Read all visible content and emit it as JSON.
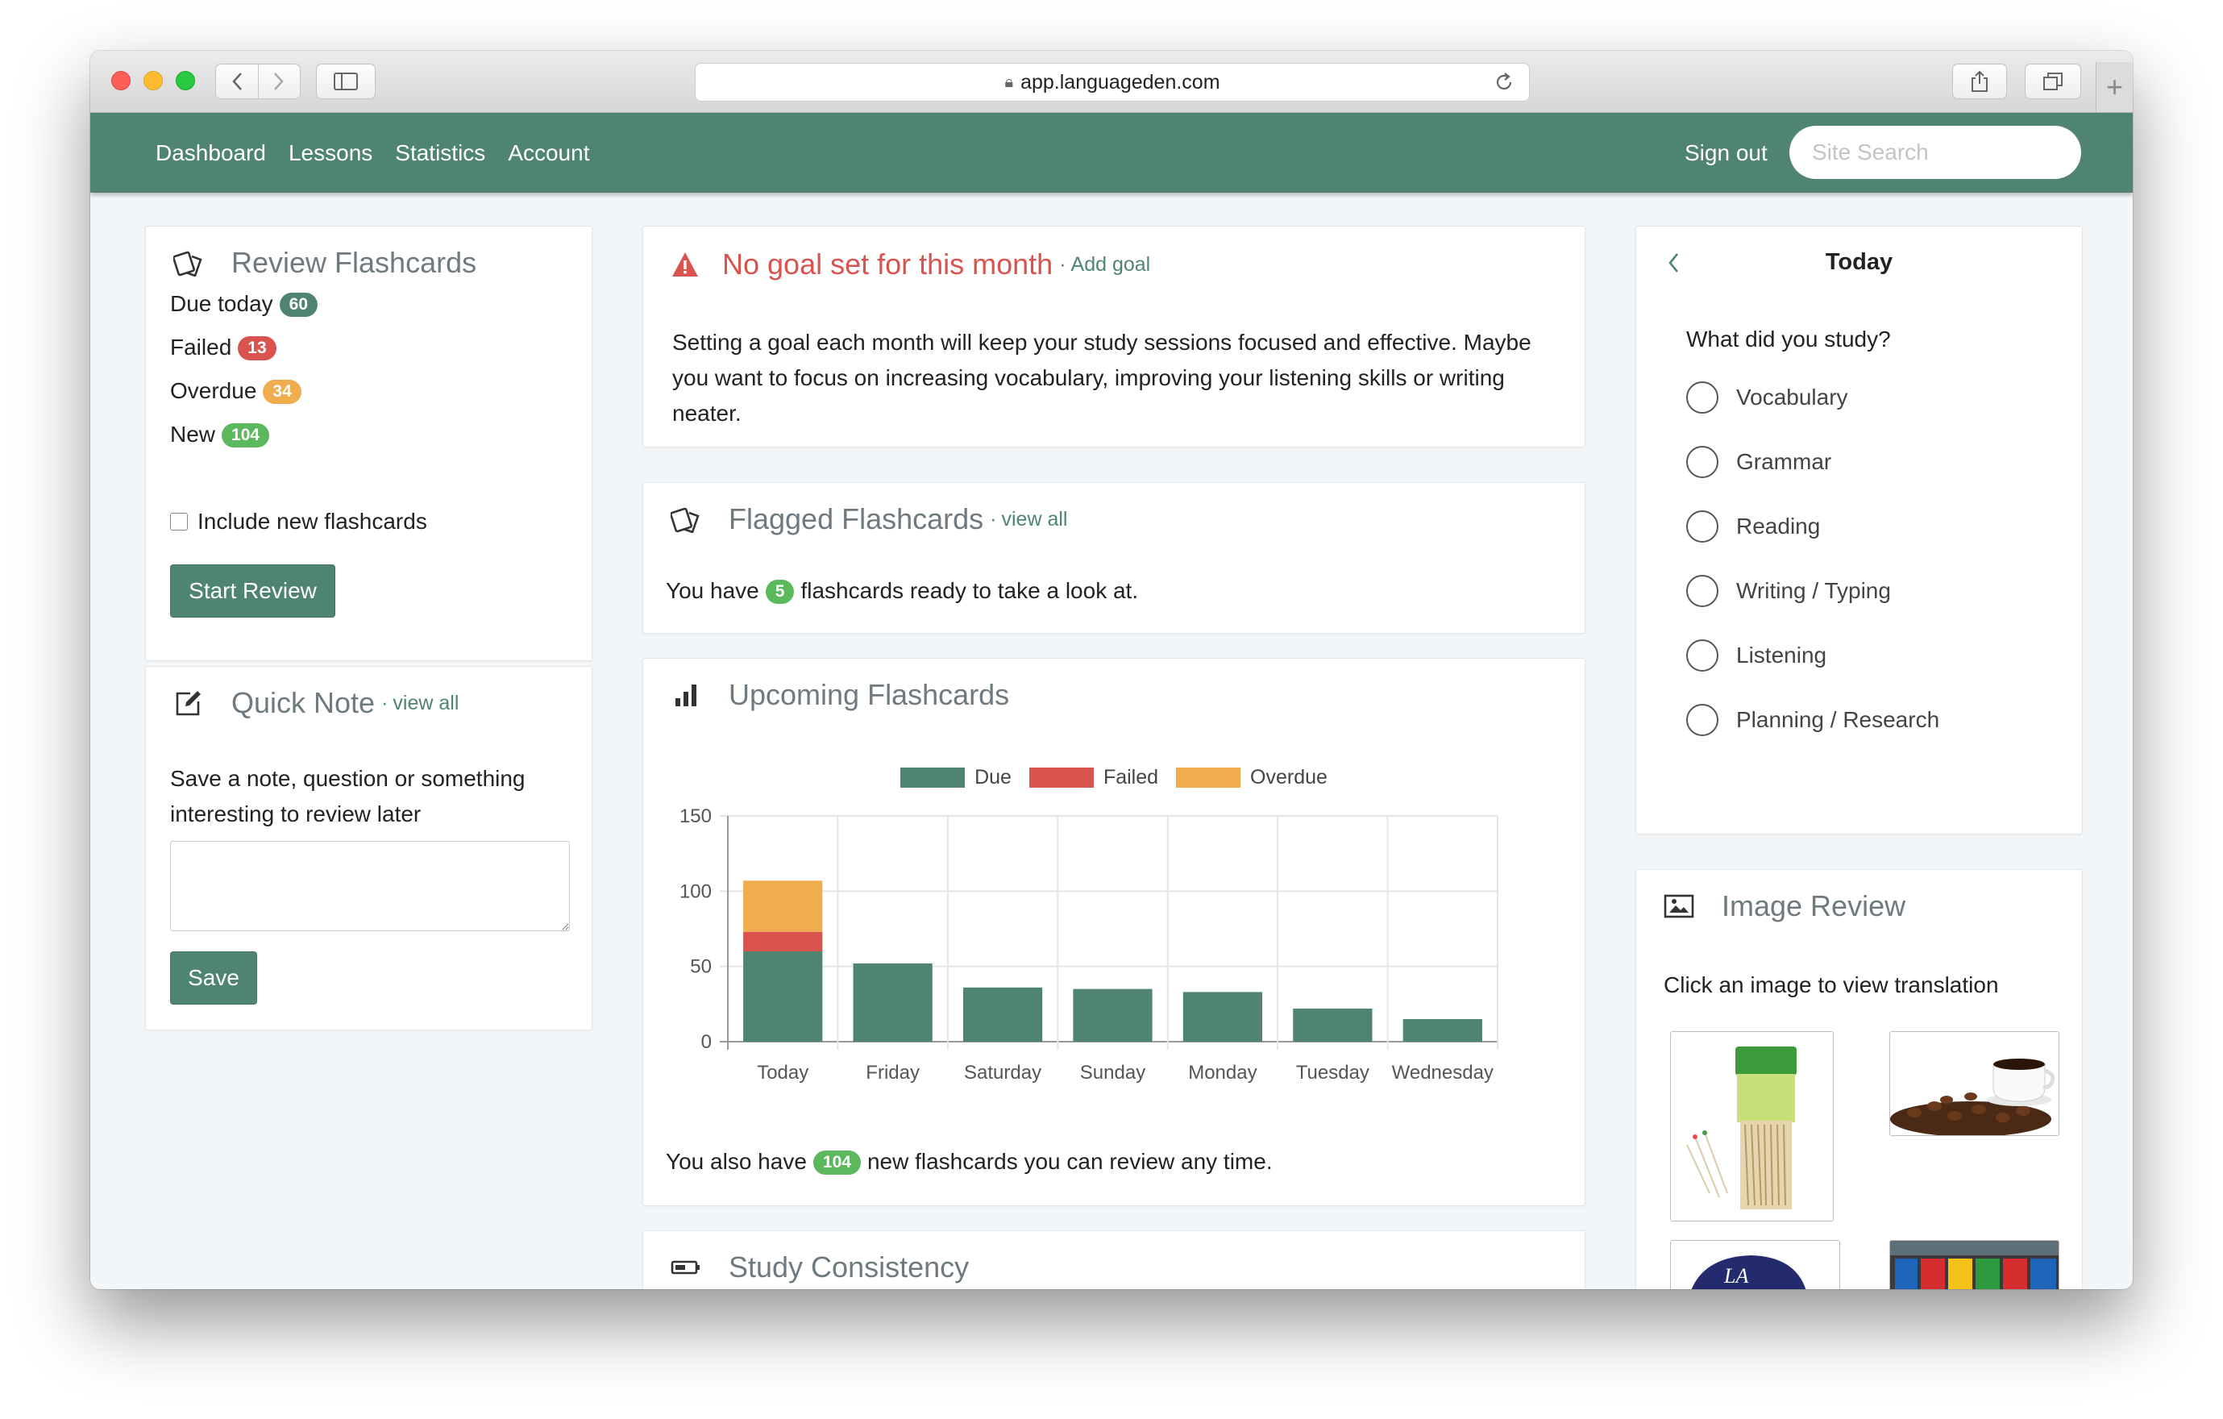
{
  "browser": {
    "url": "app.languageden.com"
  },
  "nav": {
    "links": [
      "Dashboard",
      "Lessons",
      "Statistics",
      "Account"
    ],
    "sign_out": "Sign out",
    "search_placeholder": "Site Search"
  },
  "review": {
    "title": "Review Flashcards",
    "stats": [
      {
        "label": "Due today",
        "count": "60",
        "color": "#4f8472"
      },
      {
        "label": "Failed",
        "count": "13",
        "color": "#d9534f"
      },
      {
        "label": "Overdue",
        "count": "34",
        "color": "#f0ad4e"
      },
      {
        "label": "New",
        "count": "104",
        "color": "#5cb85c"
      }
    ],
    "checkbox_label": "Include new flashcards",
    "button": "Start Review"
  },
  "quick_note": {
    "title": "Quick Note",
    "view_all": "view all",
    "text": "Save a note, question or something interesting to review later",
    "button": "Save"
  },
  "goal": {
    "title": "No goal set for this month",
    "add_goal": "Add goal",
    "text": "Setting a goal each month will keep your study sessions focused and effective. Maybe you want to focus on increasing vocabulary, improving your listening skills or writing neater."
  },
  "flagged": {
    "title": "Flagged Flashcards",
    "view_all": "view all",
    "text_before": "You have",
    "count": "5",
    "text_after": "flashcards ready to take a look at."
  },
  "upcoming": {
    "title": "Upcoming Flashcards",
    "text_before": "You also have",
    "count": "104",
    "text_after": "new flashcards you can review any time."
  },
  "chart_data": {
    "type": "bar",
    "stacked": true,
    "categories": [
      "Today",
      "Friday",
      "Saturday",
      "Sunday",
      "Monday",
      "Tuesday",
      "Wednesday"
    ],
    "series": [
      {
        "name": "Due",
        "color": "#4f8472",
        "values": [
          60,
          52,
          36,
          35,
          33,
          22,
          15
        ]
      },
      {
        "name": "Failed",
        "color": "#d9534f",
        "values": [
          13,
          0,
          0,
          0,
          0,
          0,
          0
        ]
      },
      {
        "name": "Overdue",
        "color": "#f0ad4e",
        "values": [
          34,
          0,
          0,
          0,
          0,
          0,
          0
        ]
      }
    ],
    "ylim": [
      0,
      150
    ],
    "yticks": [
      0,
      50,
      100,
      150
    ],
    "legend": "top",
    "grid": true
  },
  "consistency": {
    "title": "Study Consistency"
  },
  "today": {
    "title": "Today",
    "question": "What did you study?",
    "options": [
      "Vocabulary",
      "Grammar",
      "Reading",
      "Writing / Typing",
      "Listening",
      "Planning / Research"
    ]
  },
  "image_review": {
    "title": "Image Review",
    "text": "Click an image to view translation",
    "images": [
      "toothpicks",
      "coffee",
      "baseball-cap",
      "store-shelf"
    ]
  }
}
